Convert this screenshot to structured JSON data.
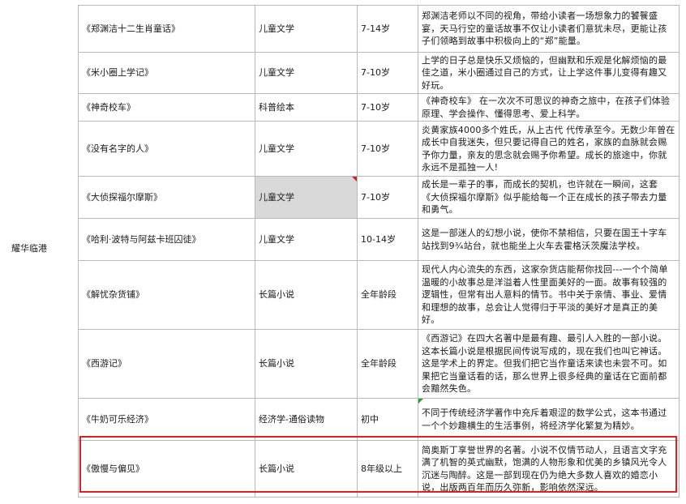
{
  "region_label": "耀华临港",
  "rows": [
    {
      "title": "《郑渊洁十二生肖童话》",
      "category": "儿童文学",
      "age": "7-14岁",
      "desc": "郑渊洁老师以不同的视角，带给小读者一场想象力的饕餮盛宴，天马行空的童话故事不仅让小读者们意犹未尽，更能让孩子们领略到故事中积极向上的“郑”能量。"
    },
    {
      "title": "《米小圈上学记》",
      "category": "儿童文学",
      "age": "7-10岁",
      "desc": "上学的日子总是快乐又烦恼的，但幽默和乐观是化解烦恼的最佳之道，米小圈通过自己的方式，让上学这件事儿变得有趣又好玩。"
    },
    {
      "title": "《神奇校车》",
      "category": "科普绘本",
      "age": "7-10岁",
      "desc": "《神奇校车》   在一次次不可思议的神奇之旅中，在孩子们体验原理、学会操作、懂得思考、爱上科学。"
    },
    {
      "title": "《没有名字的人》",
      "category": "儿童文学",
      "age": "7-10岁",
      "desc": "炎黄家族4000多个姓氏，从上古代 代传承至今。无数少年曾在成长中自我迷失，但只要记得自己的姓名，家族的血脉就会赐予你力量，亲友的思念就会赐予你希望。成长的旅途中，你就永远不是孤独一人!"
    },
    {
      "title": "《大侦探福尔摩斯》",
      "category": "儿童文学",
      "age": "7-10岁",
      "desc": "成长是一辈子的事，而成长的契机，也许就在一瞬间，这套《大侦探福尔摩斯》似乎能给每一个正在成长的孩子带去力量和勇气。"
    },
    {
      "title": "《哈利·波特与阿兹卡班囚徒》",
      "category": "儿童文学",
      "age": "10-14岁",
      "desc": "这是一部迷人的幻想小说，使你不禁相信，只要在国王十字车站找到9¾站台，就也能坐上火车去霍格沃茨魔法学校。"
    },
    {
      "title": "《解忧杂货铺》",
      "category": "长篇小说",
      "age": "全年龄段",
      "desc": "现代人内心流失的东西，这家杂货店能帮你找回---一个个简单温暖的小故事总是洋溢着人性里面美好的一面。故事有较强的逻辑性，但常有出人意料的情节。书中关于亲情、事业、爱情和理想的故事，总会让人觉得归于平淡的美好才是真正的美好。"
    },
    {
      "title": "《西游记》",
      "category": "长篇小说",
      "age": "全年龄段",
      "desc": "《西游记》在四大名著中是最有趣、最引人入胜的一部小说。这本长篇小说是根据民间传说写成的，现在我们也叫它神话。这是学术上的界定。但我们把它当作童话来读也未尝不可。如果把它当童话看的话，那么世界上很多经典的童话在它面前都会黯然失色。"
    },
    {
      "title": "《牛奶可乐经济》",
      "category": "经济学-通俗读物",
      "age": "初中",
      "desc": "不同于传统经济学著作中充斥着艰涩的数学公式，这本书通过一个个妙趣横生的生活事例，将经济学化繁复为精妙。"
    },
    {
      "title": "《傲慢与偏见》",
      "category": "长篇小说",
      "age": "8年级以上",
      "desc": "简奥斯丁享誉世界的名著。小说不仅情节动人，且语言文字充满了机智的英式幽默，饱满的人物形象和优美的乡镇风光令人沉迷与陶醉。这是一部到现在仍为绝大多数人喜欢的婚恋小说，出版两百年而历久弥新，影响依然深远。"
    }
  ]
}
